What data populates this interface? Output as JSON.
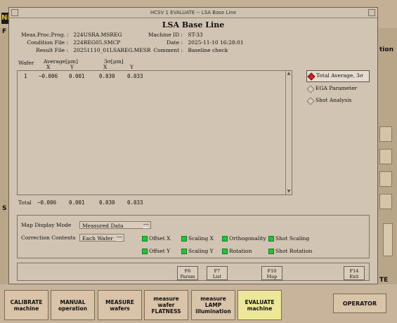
{
  "window_title": "HCSV 1 EVALUATE -- LSA Base Line",
  "dialog_title": "LSA Base Line",
  "info": {
    "meas_prog_label": "Meas.Proc.Prog. :",
    "meas_prog_value": "224USRA.MSREG",
    "condition_label": "Condition File :",
    "condition_value": "224REG05.SMCP",
    "result_label": "Result File :",
    "result_value": "20251110_01LSAREG.MESR",
    "machine_label": "Machine ID :",
    "machine_value": "ST-33",
    "date_label": "Date :",
    "date_value": "2025-11-10 16:28:01",
    "comment_label": "Comment :",
    "comment_value": "Baseline check"
  },
  "table": {
    "col_wafer": "Wafer",
    "col_average": "Average[μm]",
    "col_3sigma": "3σ[μm]",
    "sub_x1": "X",
    "sub_y1": "Y",
    "sub_x2": "X",
    "sub_y2": "Y",
    "rows": [
      {
        "wafer": "1",
        "avg_x": "−0.006",
        "avg_y": "0.001",
        "s_x": "0.030",
        "s_y": "0.033"
      }
    ],
    "total_label": "Total",
    "total": {
      "avg_x": "−0.006",
      "avg_y": "0.001",
      "s_x": "0.030",
      "s_y": "0.033"
    }
  },
  "radios": {
    "opt1": "Total Average, 3σ",
    "opt2": "EGA Parameter",
    "opt3": "Shot Analysis"
  },
  "settings": {
    "map_mode_label": "Map Display Mode",
    "map_mode_value": "Measured Data",
    "correction_label": "Correction Contents",
    "correction_value": "Each Wafer",
    "checks": {
      "offset_x": "Offset X",
      "scaling_x": "Scaling X",
      "orthogonality": "Orthogonality",
      "shot_scaling": "Shot Scaling",
      "offset_y": "Offset Y",
      "scaling_y": "Scaling Y",
      "rotation": "Rotation",
      "shot_rotation": "Shot Rotation"
    }
  },
  "fkeys": {
    "f6_key": "F6",
    "f6_label": "Param",
    "f7_key": "F7",
    "f7_label": "List",
    "f10_key": "F10",
    "f10_label": "Map",
    "f14_key": "F14",
    "f14_label": "Exit"
  },
  "bottom": {
    "calibrate": "CALIBRATE machine",
    "manual": "MANUAL operation",
    "measure_wafers": "MEASURE wafers",
    "measure_flatness": "measure wafer FLATNESS",
    "measure_lamp": "measure LAMP illumination",
    "evaluate": "EVALUATE machine",
    "operator": "OPERATOR"
  },
  "background": {
    "logo": "Ni",
    "frag_f": "F",
    "frag_s": "S",
    "frag_tion": "tion",
    "frag_te": "TE"
  },
  "colors": {
    "active_tab": "#ede79a",
    "checkbox_on": "#22c33a",
    "radio_selected": "#cc2222"
  }
}
